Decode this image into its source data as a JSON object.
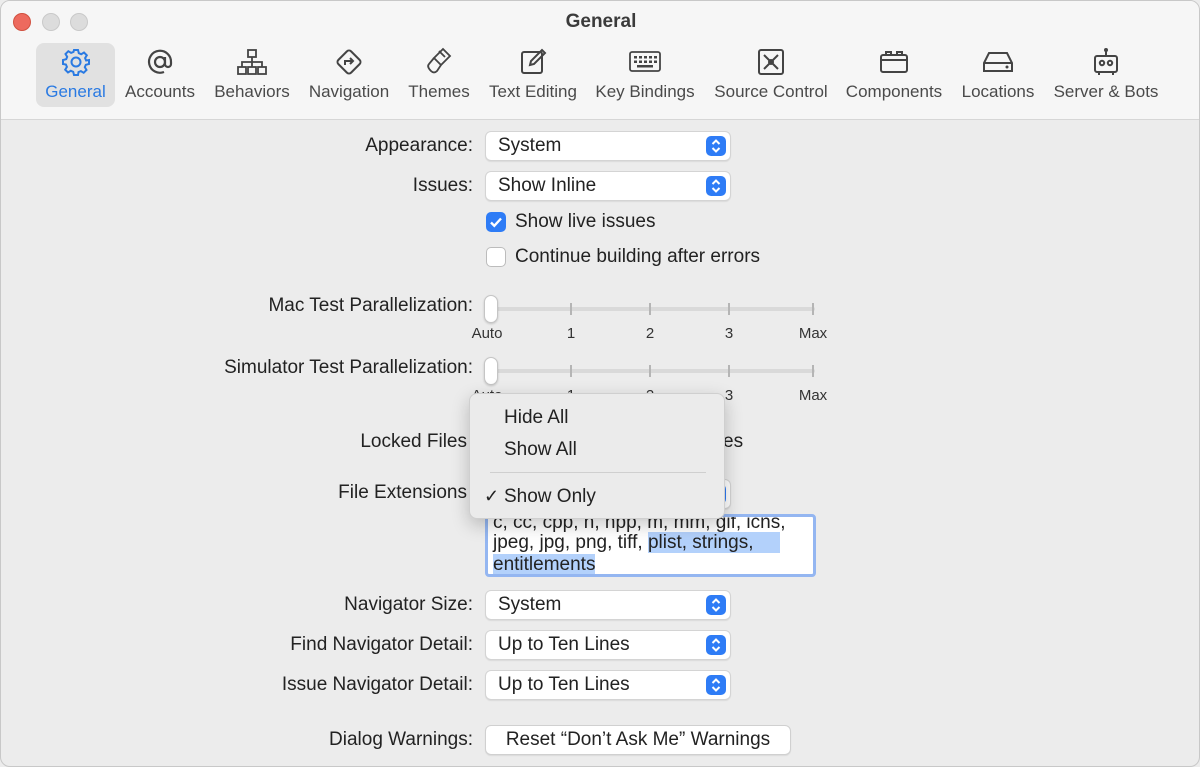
{
  "window": {
    "title": "General"
  },
  "toolbar": {
    "tabs": [
      {
        "label": "General",
        "icon": "gear-icon",
        "active": true
      },
      {
        "label": "Accounts",
        "icon": "at-icon",
        "active": false
      },
      {
        "label": "Behaviors",
        "icon": "behaviors-icon",
        "active": false
      },
      {
        "label": "Navigation",
        "icon": "navigation-icon",
        "active": false
      },
      {
        "label": "Themes",
        "icon": "brush-icon",
        "active": false
      },
      {
        "label": "Text Editing",
        "icon": "edit-icon",
        "active": false
      },
      {
        "label": "Key Bindings",
        "icon": "keyboard-icon",
        "active": false
      },
      {
        "label": "Source Control",
        "icon": "source-control-icon",
        "active": false
      },
      {
        "label": "Components",
        "icon": "components-icon",
        "active": false
      },
      {
        "label": "Locations",
        "icon": "drive-icon",
        "active": false
      },
      {
        "label": "Server & Bots",
        "icon": "robot-icon",
        "active": false
      }
    ]
  },
  "settings": {
    "appearance": {
      "label": "Appearance:",
      "value": "System"
    },
    "issues": {
      "label": "Issues:",
      "value": "Show Inline"
    },
    "show_live_issues": {
      "label": "Show live issues",
      "checked": true
    },
    "continue_building": {
      "label": "Continue building after errors",
      "checked": false
    },
    "mac_test_parallelization": {
      "label": "Mac Test Parallelization:",
      "ticks": [
        "Auto",
        "1",
        "2",
        "3",
        "Max"
      ],
      "value": "Auto"
    },
    "simulator_test_parallelization": {
      "label": "Simulator Test Parallelization:",
      "ticks": [
        "Auto",
        "1",
        "2",
        "3",
        "Max"
      ],
      "value": "Auto"
    },
    "locked_files": {
      "label": "Locked Files",
      "partial_value": "es"
    },
    "file_extensions": {
      "label": "File Extensions",
      "text_line1": "c, cc, cpp, h, hpp, m, mm, gif, icns,",
      "text_line2_plain": "jpeg, jpg, png, tiff, ",
      "text_line2_selected": "plist, strings,",
      "text_line3_selected": "entitlements"
    },
    "navigator_size": {
      "label": "Navigator Size:",
      "value": "System"
    },
    "find_navigator_detail": {
      "label": "Find Navigator Detail:",
      "value": "Up to Ten Lines"
    },
    "issue_navigator_detail": {
      "label": "Issue Navigator Detail:",
      "value": "Up to Ten Lines"
    },
    "dialog_warnings": {
      "label": "Dialog Warnings:",
      "button": "Reset “Don’t Ask Me” Warnings"
    }
  },
  "dropdown_menu": {
    "items": [
      {
        "label": "Hide All",
        "checked": false
      },
      {
        "label": "Show All",
        "checked": false
      },
      {
        "label": "Show Only",
        "checked": true
      }
    ],
    "check_glyph": "✓"
  },
  "colors": {
    "accent": "#2e7cf6",
    "selection": "#b3d1fb",
    "close": "#ed6a5e"
  }
}
